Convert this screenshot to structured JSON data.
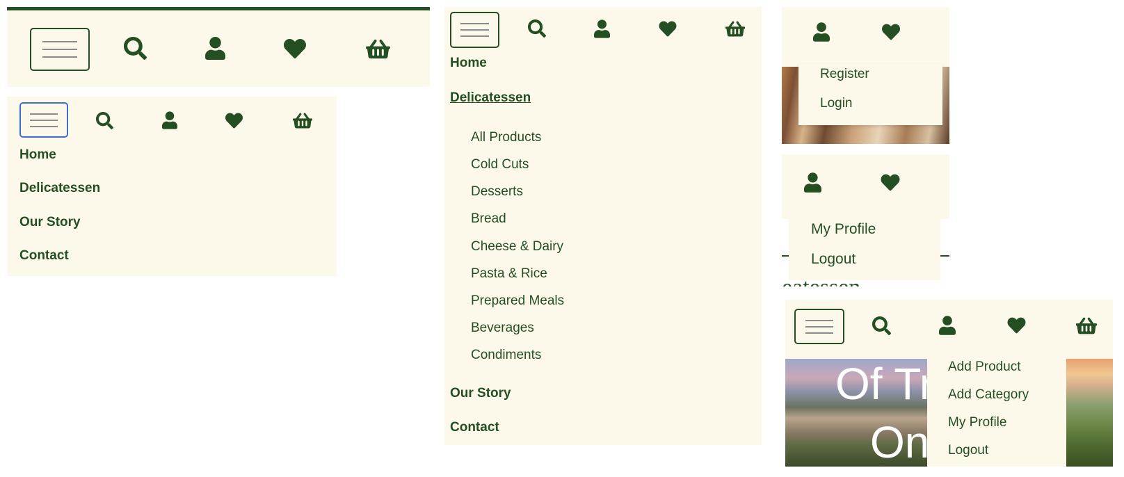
{
  "icons": {
    "menu": "hamburger-icon",
    "search": "search-icon",
    "account": "user-icon",
    "wishlist": "heart-icon",
    "cart": "basket-icon"
  },
  "colors": {
    "primary": "#234f23",
    "background": "#fdf9ea",
    "focus": "#3a6fd1",
    "hamburger_lines": "#8a8a8a"
  },
  "nav_collapsed": {
    "links": [
      {
        "label": "Home"
      },
      {
        "label": "Delicatessen"
      },
      {
        "label": "Our Story"
      },
      {
        "label": "Contact"
      }
    ]
  },
  "nav_expanded": {
    "home": "Home",
    "delicatessen": "Delicatessen",
    "categories": [
      {
        "label": "All Products"
      },
      {
        "label": "Cold Cuts"
      },
      {
        "label": "Desserts"
      },
      {
        "label": "Bread"
      },
      {
        "label": "Cheese & Dairy"
      },
      {
        "label": "Pasta & Rice"
      },
      {
        "label": "Prepared Meals"
      },
      {
        "label": "Beverages"
      },
      {
        "label": "Condiments"
      }
    ],
    "our_story": "Our Story",
    "contact": "Contact"
  },
  "account_guest": {
    "items": [
      {
        "label": "Register"
      },
      {
        "label": "Login"
      }
    ]
  },
  "account_user": {
    "items": [
      {
        "label": "My Profile"
      },
      {
        "label": "Logout"
      }
    ],
    "partial_heading": "eatessen"
  },
  "account_admin": {
    "items": [
      {
        "label": "Add Product"
      },
      {
        "label": "Add Category"
      },
      {
        "label": "My Profile"
      },
      {
        "label": "Logout"
      }
    ],
    "hero_text": [
      "Of Tr",
      "On"
    ]
  }
}
